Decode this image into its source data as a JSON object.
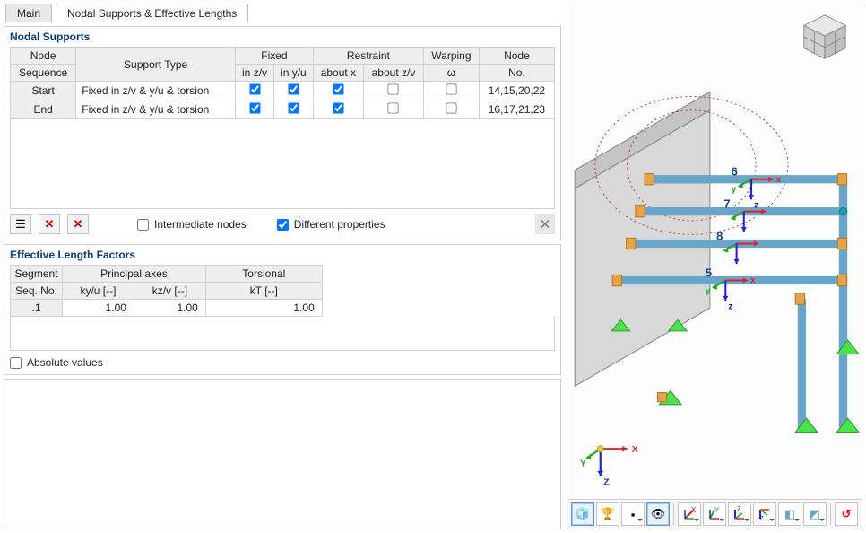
{
  "tabs": {
    "main": "Main",
    "nodal": "Nodal Supports & Effective Lengths"
  },
  "nodal_supports": {
    "title": "Nodal Supports",
    "headers": {
      "seq_top": "Node",
      "seq_bot": "Sequence",
      "support_type": "Support Type",
      "fixed": "Fixed",
      "fixed_zv": "in z/v",
      "fixed_yu": "in y/u",
      "restraint": "Restraint",
      "restraint_x": "about x",
      "restraint_zv": "about z/v",
      "warping": "Warping",
      "warping_w": "ω",
      "node": "Node",
      "node_no": "No."
    },
    "rows": [
      {
        "seq": "Start",
        "type": "Fixed in z/v & y/u & torsion",
        "fix_zv": true,
        "fix_yu": true,
        "r_x": true,
        "r_zv": false,
        "warp": false,
        "nodes": "14,15,20,22"
      },
      {
        "seq": "End",
        "type": "Fixed in z/v & y/u & torsion",
        "fix_zv": true,
        "fix_yu": true,
        "r_x": true,
        "r_zv": false,
        "warp": false,
        "nodes": "16,17,21,23"
      }
    ],
    "footer": {
      "intermediate": "Intermediate nodes",
      "different": "Different properties"
    }
  },
  "effective_length": {
    "title": "Effective Length Factors",
    "headers": {
      "seg_top": "Segment",
      "seg_bot": "Seq. No.",
      "principal": "Principal axes",
      "kyu": "ky/u [--]",
      "kzv": "kz/v [--]",
      "torsional": "Torsional",
      "kt": "kT [--]"
    },
    "rows": [
      {
        "seq": ".1",
        "kyu": "1.00",
        "kzv": "1.00",
        "kt": "1.00"
      }
    ],
    "absolute": "Absolute values"
  },
  "viewport": {
    "members": [
      "6",
      "7",
      "8",
      "5"
    ],
    "axis_x": "x",
    "axis_y": "y",
    "axis_z": "z",
    "triad_x": "X",
    "triad_y": "Y",
    "triad_z": "Z"
  },
  "tool_names": {
    "render": "render-mode",
    "wire": "wireframe-mode",
    "fit": "zoom-fit",
    "view": "view-options",
    "axis_x": "axis-x-dir",
    "axis_y": "axis-y-dir",
    "axis_z": "axis-z-dir",
    "axis_neg_z": "axis-neg-z-dir",
    "iso": "iso-view",
    "clip": "clip-plane",
    "reset": "reset-view"
  }
}
